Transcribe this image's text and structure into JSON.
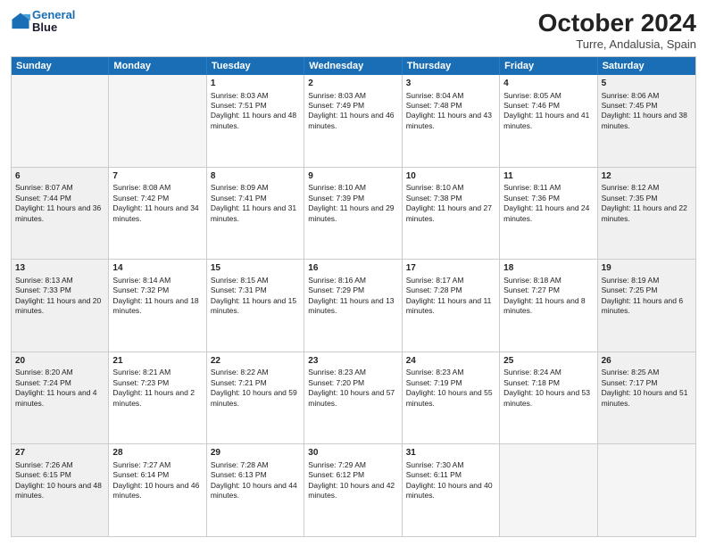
{
  "logo": {
    "line1": "General",
    "line2": "Blue"
  },
  "title": "October 2024",
  "location": "Turre, Andalusia, Spain",
  "days_of_week": [
    "Sunday",
    "Monday",
    "Tuesday",
    "Wednesday",
    "Thursday",
    "Friday",
    "Saturday"
  ],
  "weeks": [
    [
      {
        "day": "",
        "empty": true
      },
      {
        "day": "",
        "empty": true
      },
      {
        "day": "1",
        "sunrise": "Sunrise: 8:03 AM",
        "sunset": "Sunset: 7:51 PM",
        "daylight": "Daylight: 11 hours and 48 minutes."
      },
      {
        "day": "2",
        "sunrise": "Sunrise: 8:03 AM",
        "sunset": "Sunset: 7:49 PM",
        "daylight": "Daylight: 11 hours and 46 minutes."
      },
      {
        "day": "3",
        "sunrise": "Sunrise: 8:04 AM",
        "sunset": "Sunset: 7:48 PM",
        "daylight": "Daylight: 11 hours and 43 minutes."
      },
      {
        "day": "4",
        "sunrise": "Sunrise: 8:05 AM",
        "sunset": "Sunset: 7:46 PM",
        "daylight": "Daylight: 11 hours and 41 minutes."
      },
      {
        "day": "5",
        "sunrise": "Sunrise: 8:06 AM",
        "sunset": "Sunset: 7:45 PM",
        "daylight": "Daylight: 11 hours and 38 minutes."
      }
    ],
    [
      {
        "day": "6",
        "sunrise": "Sunrise: 8:07 AM",
        "sunset": "Sunset: 7:44 PM",
        "daylight": "Daylight: 11 hours and 36 minutes."
      },
      {
        "day": "7",
        "sunrise": "Sunrise: 8:08 AM",
        "sunset": "Sunset: 7:42 PM",
        "daylight": "Daylight: 11 hours and 34 minutes."
      },
      {
        "day": "8",
        "sunrise": "Sunrise: 8:09 AM",
        "sunset": "Sunset: 7:41 PM",
        "daylight": "Daylight: 11 hours and 31 minutes."
      },
      {
        "day": "9",
        "sunrise": "Sunrise: 8:10 AM",
        "sunset": "Sunset: 7:39 PM",
        "daylight": "Daylight: 11 hours and 29 minutes."
      },
      {
        "day": "10",
        "sunrise": "Sunrise: 8:10 AM",
        "sunset": "Sunset: 7:38 PM",
        "daylight": "Daylight: 11 hours and 27 minutes."
      },
      {
        "day": "11",
        "sunrise": "Sunrise: 8:11 AM",
        "sunset": "Sunset: 7:36 PM",
        "daylight": "Daylight: 11 hours and 24 minutes."
      },
      {
        "day": "12",
        "sunrise": "Sunrise: 8:12 AM",
        "sunset": "Sunset: 7:35 PM",
        "daylight": "Daylight: 11 hours and 22 minutes."
      }
    ],
    [
      {
        "day": "13",
        "sunrise": "Sunrise: 8:13 AM",
        "sunset": "Sunset: 7:33 PM",
        "daylight": "Daylight: 11 hours and 20 minutes."
      },
      {
        "day": "14",
        "sunrise": "Sunrise: 8:14 AM",
        "sunset": "Sunset: 7:32 PM",
        "daylight": "Daylight: 11 hours and 18 minutes."
      },
      {
        "day": "15",
        "sunrise": "Sunrise: 8:15 AM",
        "sunset": "Sunset: 7:31 PM",
        "daylight": "Daylight: 11 hours and 15 minutes."
      },
      {
        "day": "16",
        "sunrise": "Sunrise: 8:16 AM",
        "sunset": "Sunset: 7:29 PM",
        "daylight": "Daylight: 11 hours and 13 minutes."
      },
      {
        "day": "17",
        "sunrise": "Sunrise: 8:17 AM",
        "sunset": "Sunset: 7:28 PM",
        "daylight": "Daylight: 11 hours and 11 minutes."
      },
      {
        "day": "18",
        "sunrise": "Sunrise: 8:18 AM",
        "sunset": "Sunset: 7:27 PM",
        "daylight": "Daylight: 11 hours and 8 minutes."
      },
      {
        "day": "19",
        "sunrise": "Sunrise: 8:19 AM",
        "sunset": "Sunset: 7:25 PM",
        "daylight": "Daylight: 11 hours and 6 minutes."
      }
    ],
    [
      {
        "day": "20",
        "sunrise": "Sunrise: 8:20 AM",
        "sunset": "Sunset: 7:24 PM",
        "daylight": "Daylight: 11 hours and 4 minutes."
      },
      {
        "day": "21",
        "sunrise": "Sunrise: 8:21 AM",
        "sunset": "Sunset: 7:23 PM",
        "daylight": "Daylight: 11 hours and 2 minutes."
      },
      {
        "day": "22",
        "sunrise": "Sunrise: 8:22 AM",
        "sunset": "Sunset: 7:21 PM",
        "daylight": "Daylight: 10 hours and 59 minutes."
      },
      {
        "day": "23",
        "sunrise": "Sunrise: 8:23 AM",
        "sunset": "Sunset: 7:20 PM",
        "daylight": "Daylight: 10 hours and 57 minutes."
      },
      {
        "day": "24",
        "sunrise": "Sunrise: 8:23 AM",
        "sunset": "Sunset: 7:19 PM",
        "daylight": "Daylight: 10 hours and 55 minutes."
      },
      {
        "day": "25",
        "sunrise": "Sunrise: 8:24 AM",
        "sunset": "Sunset: 7:18 PM",
        "daylight": "Daylight: 10 hours and 53 minutes."
      },
      {
        "day": "26",
        "sunrise": "Sunrise: 8:25 AM",
        "sunset": "Sunset: 7:17 PM",
        "daylight": "Daylight: 10 hours and 51 minutes."
      }
    ],
    [
      {
        "day": "27",
        "sunrise": "Sunrise: 7:26 AM",
        "sunset": "Sunset: 6:15 PM",
        "daylight": "Daylight: 10 hours and 48 minutes."
      },
      {
        "day": "28",
        "sunrise": "Sunrise: 7:27 AM",
        "sunset": "Sunset: 6:14 PM",
        "daylight": "Daylight: 10 hours and 46 minutes."
      },
      {
        "day": "29",
        "sunrise": "Sunrise: 7:28 AM",
        "sunset": "Sunset: 6:13 PM",
        "daylight": "Daylight: 10 hours and 44 minutes."
      },
      {
        "day": "30",
        "sunrise": "Sunrise: 7:29 AM",
        "sunset": "Sunset: 6:12 PM",
        "daylight": "Daylight: 10 hours and 42 minutes."
      },
      {
        "day": "31",
        "sunrise": "Sunrise: 7:30 AM",
        "sunset": "Sunset: 6:11 PM",
        "daylight": "Daylight: 10 hours and 40 minutes."
      },
      {
        "day": "",
        "empty": true
      },
      {
        "day": "",
        "empty": true
      }
    ]
  ]
}
